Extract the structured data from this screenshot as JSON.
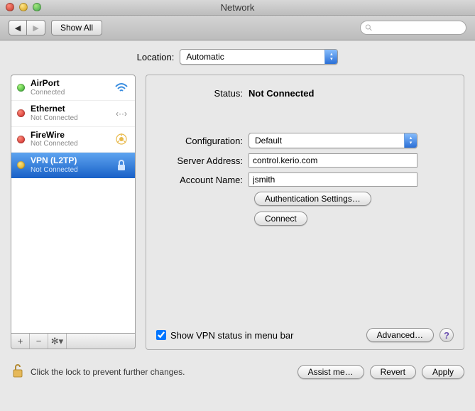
{
  "window": {
    "title": "Network"
  },
  "toolbar": {
    "show_all": "Show All",
    "search_placeholder": ""
  },
  "location": {
    "label": "Location:",
    "value": "Automatic"
  },
  "sidebar": {
    "items": [
      {
        "name": "AirPort",
        "status": "Connected",
        "dot": "green",
        "icon": "wifi",
        "selected": false
      },
      {
        "name": "Ethernet",
        "status": "Not Connected",
        "dot": "red",
        "icon": "ethernet",
        "selected": false
      },
      {
        "name": "FireWire",
        "status": "Not Connected",
        "dot": "red",
        "icon": "firewire",
        "selected": false
      },
      {
        "name": "VPN (L2TP)",
        "status": "Not Connected",
        "dot": "yellow",
        "icon": "lock",
        "selected": true
      }
    ]
  },
  "detail": {
    "status_label": "Status:",
    "status_value": "Not Connected",
    "config_label": "Configuration:",
    "config_value": "Default",
    "server_label": "Server Address:",
    "server_value": "control.kerio.com",
    "account_label": "Account Name:",
    "account_value": "jsmith",
    "auth_settings_btn": "Authentication Settings…",
    "connect_btn": "Connect",
    "show_vpn_status": "Show VPN status in menu bar",
    "show_vpn_checked": true,
    "advanced_btn": "Advanced…"
  },
  "footer": {
    "lock_text": "Click the lock to prevent further changes.",
    "assist_btn": "Assist me…",
    "revert_btn": "Revert",
    "apply_btn": "Apply"
  }
}
